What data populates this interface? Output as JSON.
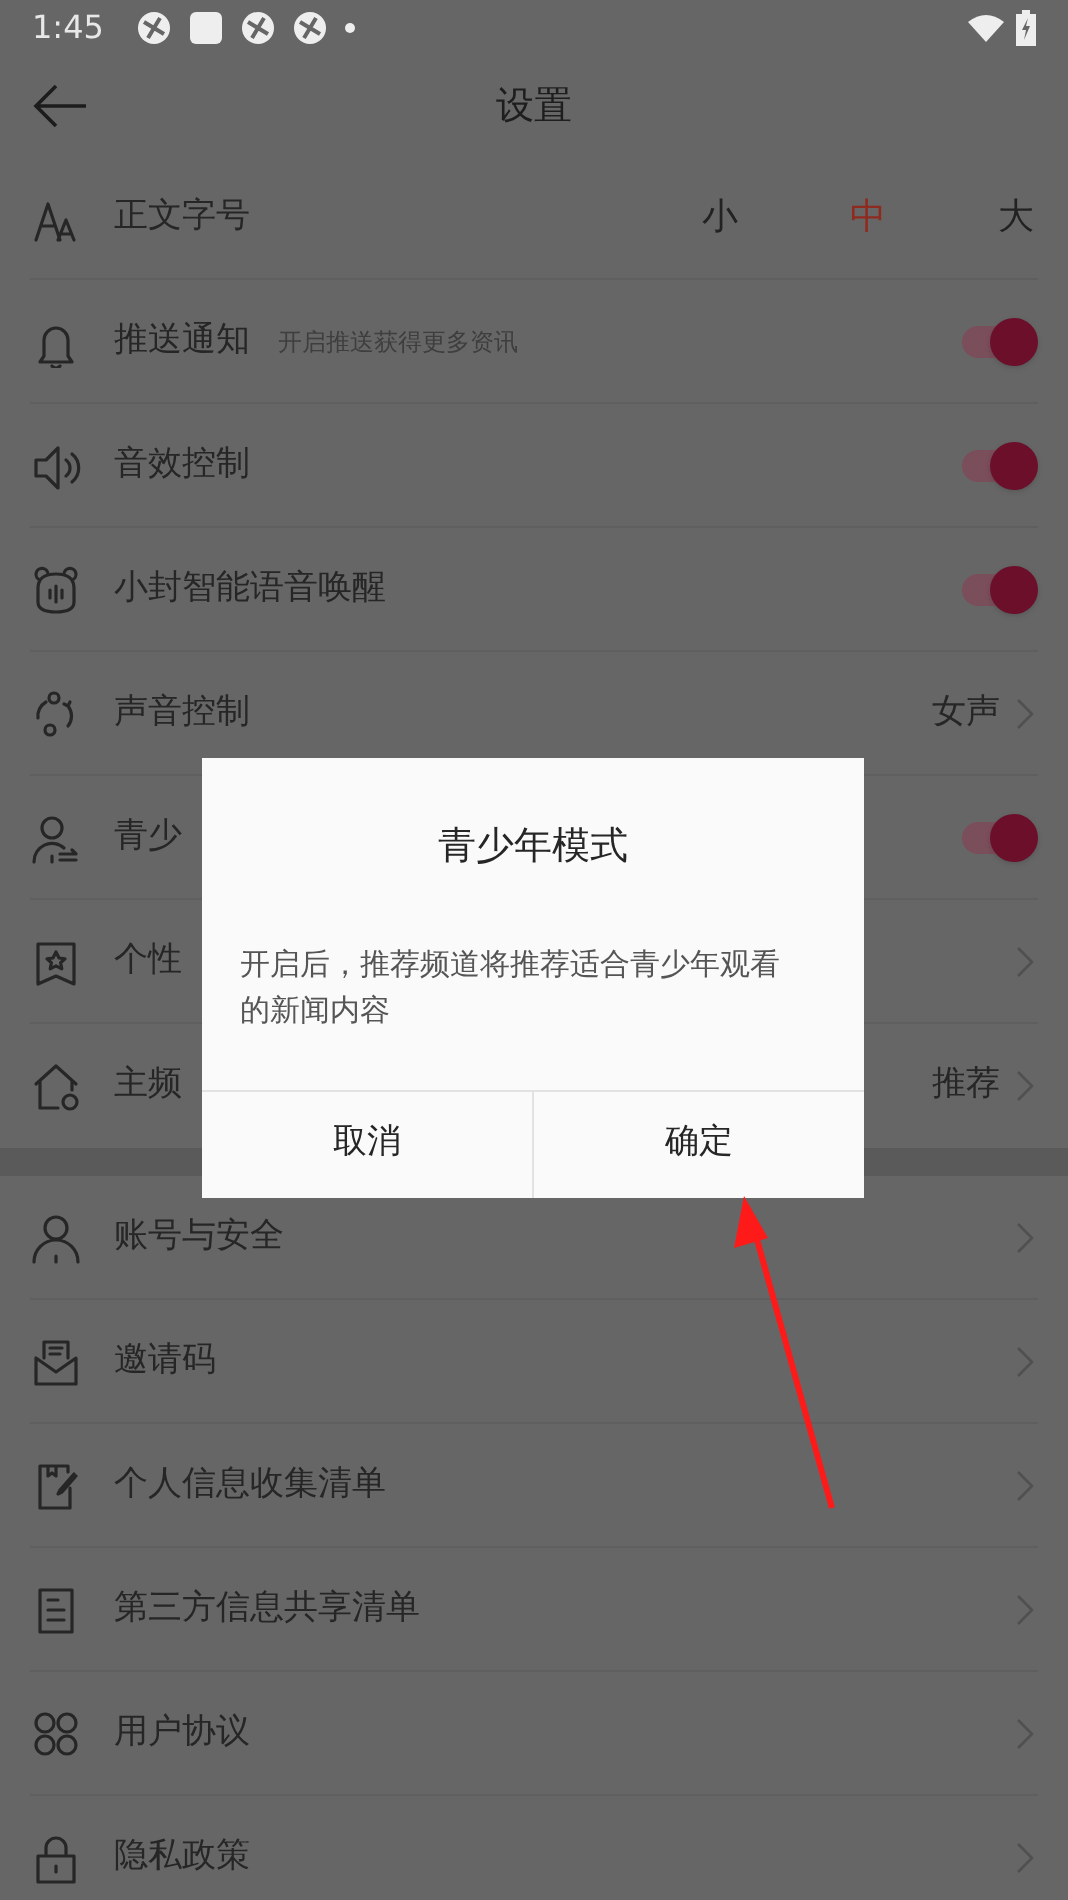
{
  "status_bar": {
    "time": "1:45"
  },
  "header": {
    "title": "设置"
  },
  "sections": [
    {
      "rows": [
        {
          "kind": "font_size",
          "label": "正文字号",
          "options": [
            {
              "label": "小",
              "selected": false
            },
            {
              "label": "中",
              "selected": true
            },
            {
              "label": "大",
              "selected": false
            }
          ]
        },
        {
          "kind": "toggle",
          "label": "推送通知",
          "hint": "开启推送获得更多资讯",
          "on": true
        },
        {
          "kind": "toggle",
          "label": "音效控制",
          "on": true
        },
        {
          "kind": "toggle",
          "label": "小封智能语音唤醒",
          "on": true
        },
        {
          "kind": "link",
          "label": "声音控制",
          "value": "女声"
        },
        {
          "kind": "toggle",
          "label": "青少",
          "on": true
        },
        {
          "kind": "link",
          "label": "个性"
        },
        {
          "kind": "link",
          "label": "主频",
          "value": "推荐"
        }
      ]
    },
    {
      "rows": [
        {
          "kind": "link",
          "label": "账号与安全"
        },
        {
          "kind": "link",
          "label": "邀请码"
        },
        {
          "kind": "link",
          "label": "个人信息收集清单"
        },
        {
          "kind": "link",
          "label": "第三方信息共享清单"
        },
        {
          "kind": "link",
          "label": "用户协议"
        },
        {
          "kind": "link",
          "label": "隐私政策"
        }
      ]
    }
  ],
  "dialog": {
    "title": "青少年模式",
    "message": "开启后，推荐频道将推荐适合青少年观看的新闻内容",
    "buttons": [
      {
        "label": "取消"
      },
      {
        "label": "确定"
      }
    ]
  }
}
